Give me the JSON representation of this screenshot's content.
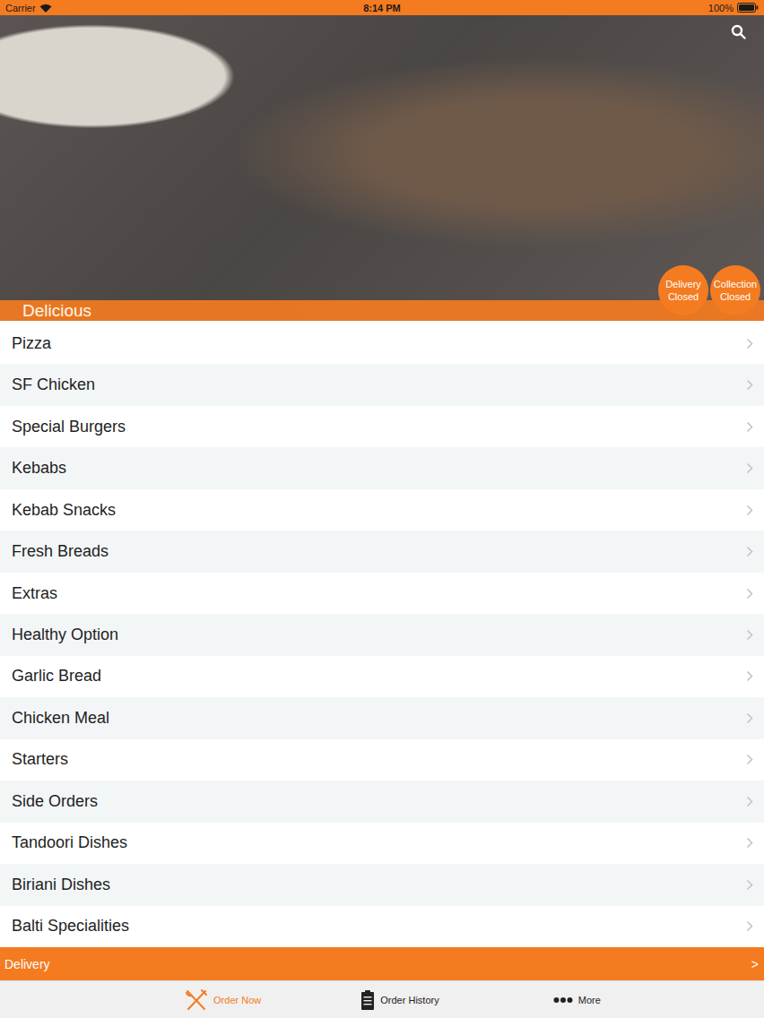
{
  "status_bar": {
    "carrier": "Carrier",
    "time": "8:14 PM",
    "battery": "100%"
  },
  "header": {
    "title": "Delicious"
  },
  "badges": [
    {
      "label": "Delivery",
      "status": "Closed"
    },
    {
      "label": "Collection",
      "status": "Closed"
    }
  ],
  "categories": [
    {
      "name": "Pizza"
    },
    {
      "name": "SF Chicken"
    },
    {
      "name": "Special Burgers"
    },
    {
      "name": "Kebabs"
    },
    {
      "name": "Kebab Snacks"
    },
    {
      "name": "Fresh Breads"
    },
    {
      "name": "Extras"
    },
    {
      "name": "Healthy Option"
    },
    {
      "name": "Garlic Bread"
    },
    {
      "name": "Chicken Meal"
    },
    {
      "name": "Starters"
    },
    {
      "name": "Side Orders"
    },
    {
      "name": "Tandoori Dishes"
    },
    {
      "name": "Biriani Dishes"
    },
    {
      "name": "Balti Specialities"
    }
  ],
  "order_bar": {
    "label": "Delivery",
    "chevron": ">"
  },
  "tabs": [
    {
      "label": "Order Now",
      "selected": true
    },
    {
      "label": "Order History",
      "selected": false
    },
    {
      "label": "More",
      "selected": false
    }
  ]
}
